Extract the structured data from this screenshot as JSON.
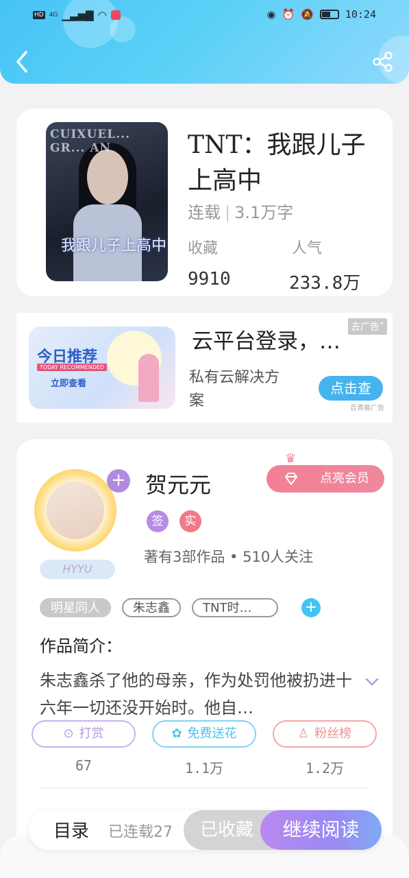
{
  "status_bar": {
    "left": [
      "HD",
      "4G",
      "signal-icon",
      "wifi-icon",
      "app-notification-icon"
    ],
    "right": [
      "eye-icon",
      "alarm-icon",
      "mute-icon",
      "battery-icon"
    ],
    "time": "10:24"
  },
  "header": {
    "back_icon": "chevron-left-icon",
    "share_icon": "share-icon",
    "accent": "#46c4f5"
  },
  "book": {
    "cover_title_en": "CUIXUEL... GR... AN",
    "cover_title_cn": "我跟儿子上高中",
    "title": "TNT：我跟儿子上高中",
    "status": "连载",
    "word_count": "3.1万字",
    "stats": [
      {
        "label": "收藏",
        "value": "9910"
      },
      {
        "label": "人气",
        "value": "233.8万"
      }
    ]
  },
  "ad": {
    "image_title": "今日推荐",
    "image_subtitle": "TODAY RECOMMENDED",
    "image_cta": "立即查看",
    "title": "云平台登录，…",
    "tag": "去广告",
    "desc": "私有云解决方案",
    "button": "点击查",
    "source": "百青藤广告"
  },
  "author": {
    "name": "贺元元",
    "avatar_label": "HYYU",
    "vip_button": "点亮会员",
    "badges": [
      {
        "label": "签",
        "color": "#b98be3"
      },
      {
        "label": "实",
        "color": "#f07a88"
      }
    ],
    "stats": "著有3部作品 • 510人关注",
    "tags": [
      "明星同人",
      "朱志鑫",
      "TNT时…"
    ],
    "intro_label": "作品简介：",
    "intro_text": "朱志鑫杀了他的母亲，作为处罚他被扔进十六年一切还没开始时。他自…",
    "actions": [
      {
        "label": "打赏",
        "icon": "yen-icon",
        "count": "67",
        "color": "#b59be6"
      },
      {
        "label": "免费送花",
        "icon": "flower-icon",
        "count": "1.1万",
        "color": "#4cc3ee"
      },
      {
        "label": "粉丝榜",
        "icon": "fans-icon",
        "count": "1.2万",
        "color": "#ef8f8f"
      }
    ]
  },
  "bottom_bar": {
    "toc": "目录",
    "serial": "已连载27",
    "collected": "已收藏",
    "read": "继续阅读"
  }
}
